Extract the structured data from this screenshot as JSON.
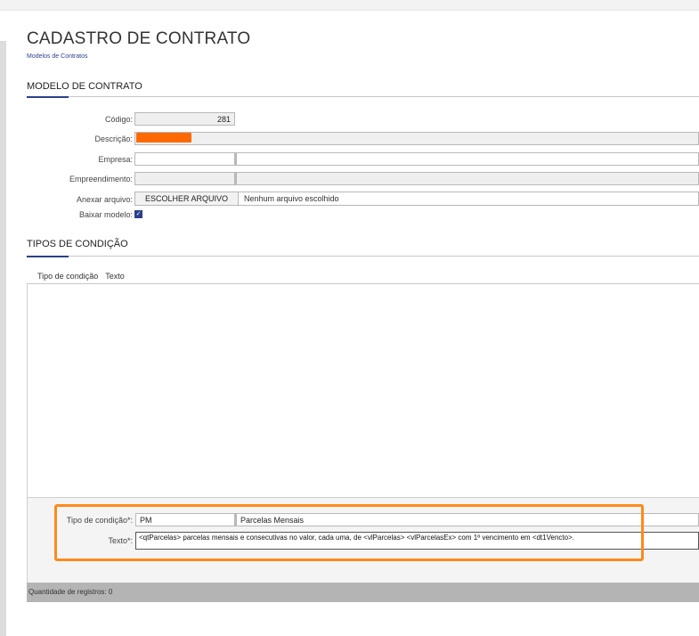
{
  "header": {
    "title": "CADASTRO DE CONTRATO",
    "breadcrumb": "Modelos de Contratos"
  },
  "modelo": {
    "section_title": "MODELO DE CONTRATO",
    "codigo_label": "Código:",
    "codigo_value": "281",
    "descricao_label": "Descrição:",
    "empresa_label": "Empresa:",
    "empreendimento_label": "Empreendimento:",
    "anexar_label": "Anexar arquivo:",
    "anexar_button": "ESCOLHER ARQUIVO",
    "anexar_status": "Nenhum arquivo escolhido",
    "baixar_label": "Baixar modelo:"
  },
  "tipos": {
    "section_title": "TIPOS DE CONDIÇÃO",
    "col_tipo": "Tipo de condição",
    "col_texto": "Texto",
    "form_tipo_label": "Tipo de condição*:",
    "form_tipo_code": "PM",
    "form_tipo_desc": "Parcelas Mensais",
    "form_texto_label": "Texto*:",
    "form_texto_value": "<qtParcelas> parcelas mensais e consecutivas no valor, cada uma, de <vlParcelas> <vlParcelasEx> com 1º vencimento em <dt1Vencto>."
  },
  "footer": {
    "records": "Quantidade de registros: 0"
  },
  "colors": {
    "accent": "#2b3f8c",
    "highlight": "#ff8a1c",
    "redaction": "#ff6a00"
  }
}
